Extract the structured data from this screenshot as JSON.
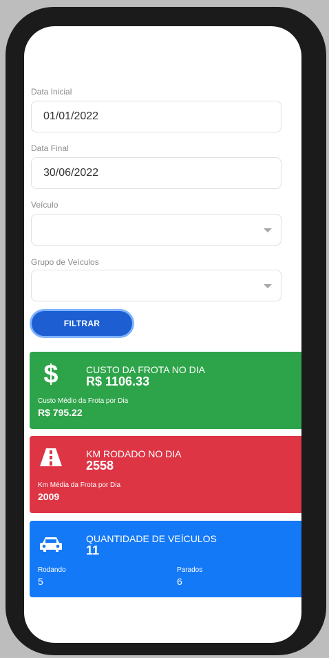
{
  "form": {
    "start_date": {
      "label": "Data Inicial",
      "value": "01/01/2022"
    },
    "end_date": {
      "label": "Data Final",
      "value": "30/06/2022"
    },
    "vehicle": {
      "label": "Veículo",
      "value": ""
    },
    "vehicle_group": {
      "label": "Grupo de Veículos",
      "value": ""
    },
    "filter_button": "FILTRAR"
  },
  "cards": {
    "cost": {
      "icon": "dollar-icon",
      "title": "CUSTO DA FROTA NO DIA",
      "value": "R$ 1106.33",
      "sub_label": "Custo Médio da Frota por Dia",
      "sub_value": "R$ 795.22",
      "color": "#2ea44a"
    },
    "km": {
      "icon": "road-icon",
      "title": "KM RODADO NO DIA",
      "value": "2558",
      "sub_label": "Km Média da Frota por Dia",
      "sub_value": "2009",
      "color": "#de3545"
    },
    "vehicles": {
      "icon": "car-icon",
      "title": "QUANTIDADE DE VEÍCULOS",
      "value": "11",
      "running_label": "Rodando",
      "running_value": "5",
      "stopped_label": "Parados",
      "stopped_value": "6",
      "color": "#1479f7"
    }
  },
  "colors": {
    "primary_button": "#1d5fd2",
    "phone_frame": "#1b1b1b",
    "background": "#bdbdbd"
  }
}
